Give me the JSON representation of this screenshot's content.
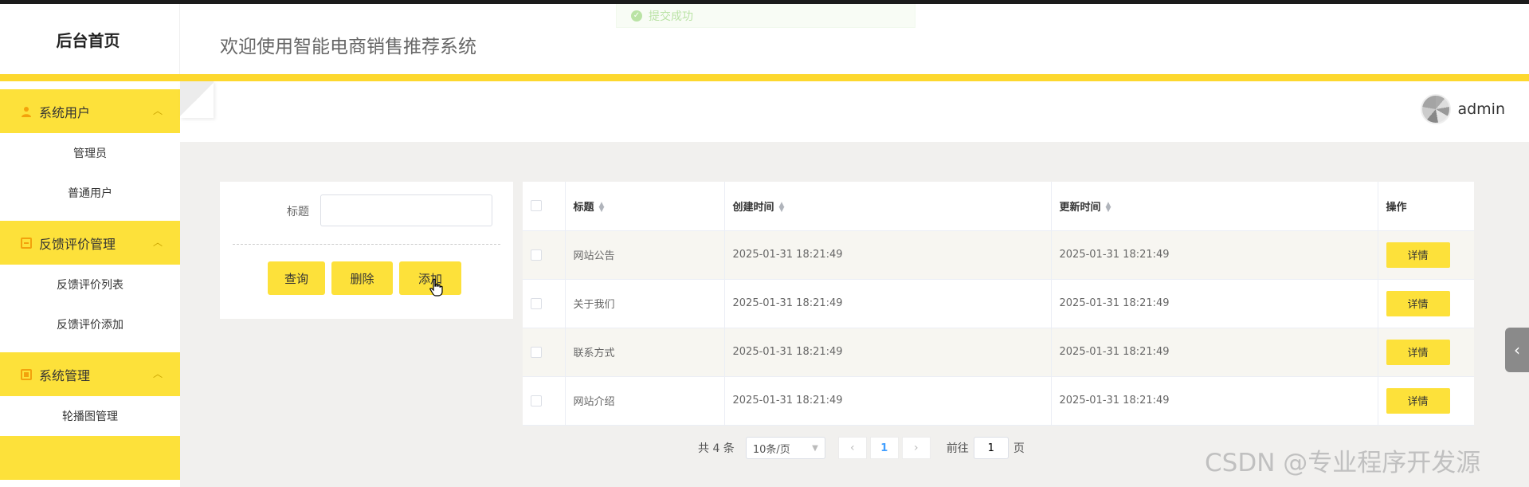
{
  "header": {
    "logo": "后台首页",
    "title": "欢迎使用智能电商销售推荐系统",
    "toast": "提交成功"
  },
  "user": {
    "name": "admin"
  },
  "sidebar": {
    "groups": [
      {
        "label": "系统用户",
        "icon": "user-icon",
        "items": [
          "管理员",
          "普通用户"
        ]
      },
      {
        "label": "反馈评价管理",
        "icon": "feedback-icon",
        "items": [
          "反馈评价列表",
          "反馈评价添加"
        ]
      },
      {
        "label": "系统管理",
        "icon": "settings-icon",
        "items": [
          "轮播图管理"
        ]
      }
    ]
  },
  "search": {
    "label": "标题",
    "value": "",
    "buttons": {
      "query": "查询",
      "delete": "删除",
      "add": "添加"
    }
  },
  "table": {
    "headers": {
      "title": "标题",
      "created": "创建时间",
      "updated": "更新时间",
      "actions": "操作"
    },
    "rows": [
      {
        "title": "网站公告",
        "created": "2025-01-31 18:21:49",
        "updated": "2025-01-31 18:21:49",
        "action": "详情"
      },
      {
        "title": "关于我们",
        "created": "2025-01-31 18:21:49",
        "updated": "2025-01-31 18:21:49",
        "action": "详情"
      },
      {
        "title": "联系方式",
        "created": "2025-01-31 18:21:49",
        "updated": "2025-01-31 18:21:49",
        "action": "详情"
      },
      {
        "title": "网站介绍",
        "created": "2025-01-31 18:21:49",
        "updated": "2025-01-31 18:21:49",
        "action": "详情"
      }
    ]
  },
  "pagination": {
    "total": "共 4 条",
    "page_size": "10条/页",
    "current_page": "1",
    "goto_prefix": "前往",
    "goto_value": "1",
    "goto_suffix": "页"
  },
  "watermark": "CSDN @专业程序开发源",
  "colors": {
    "accent": "#fde13a",
    "bar": "#fdd82e",
    "icon": "#f3a20c"
  }
}
